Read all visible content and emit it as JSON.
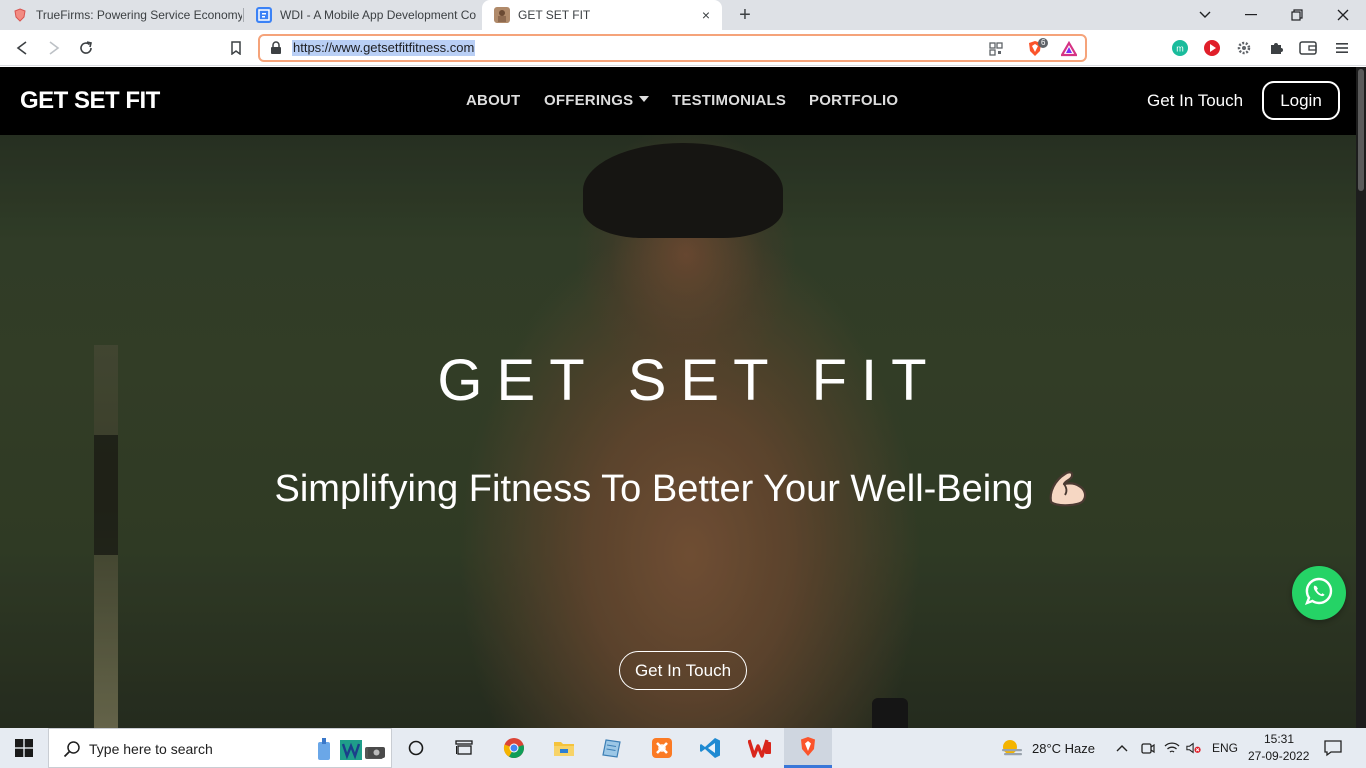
{
  "browser": {
    "tabs": [
      {
        "title": "TrueFirms: Powering Service Economy",
        "active": false
      },
      {
        "title": "WDI - A Mobile App Development Co",
        "active": false
      },
      {
        "title": "GET SET FIT",
        "active": true
      }
    ],
    "close_tab": "×",
    "new_tab": "+",
    "address": "https://www.getsetfitfitness.com",
    "brave_shield_count": "6"
  },
  "site": {
    "logo": "GET SET FIT",
    "menu": {
      "about": "ABOUT",
      "offerings": "OFFERINGS",
      "testimonials": "TESTIMONIALS",
      "portfolio": "PORTFOLIO"
    },
    "get_in_touch": "Get In Touch",
    "login": "Login"
  },
  "hero": {
    "title": "GET SET FIT",
    "subtitle": "Simplifying Fitness To Better Your Well-Being",
    "cta": "Get In Touch"
  },
  "taskbar": {
    "search_placeholder": "Type here to search",
    "weather": "28°C  Haze",
    "language": "ENG",
    "time": "15:31",
    "date": "27-09-2022"
  },
  "colors": {
    "accent_omnibox": "#f5a37a",
    "whatsapp_green": "#25d366",
    "nav_bg": "#000000"
  }
}
